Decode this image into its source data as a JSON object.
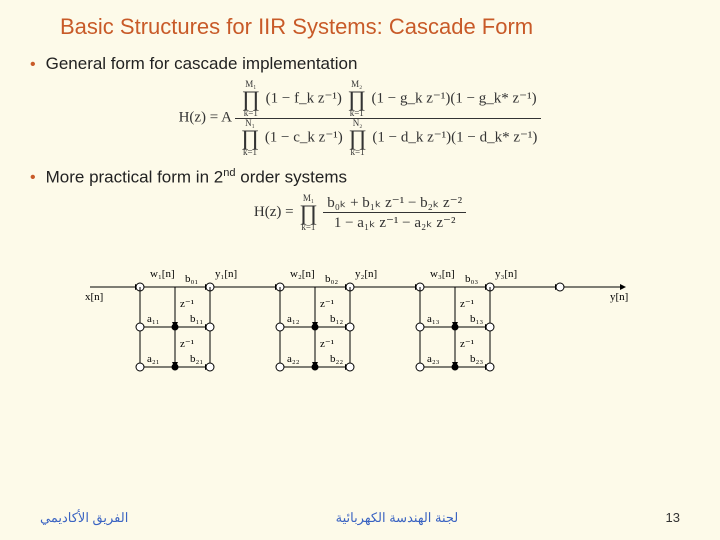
{
  "title": "Basic Structures for IIR Systems: Cascade Form",
  "bullets": {
    "b1": "General form for cascade implementation",
    "b2_pre": "More practical form in 2",
    "b2_ord": "nd",
    "b2_post": " order systems"
  },
  "eq1": {
    "lhs": "H(z) = A",
    "num_p1_top": "M₁",
    "num_p1_bot": "k=1",
    "num_p1_body": "(1 − f_k z⁻¹)",
    "num_p2_top": "M₂",
    "num_p2_bot": "k=1",
    "num_p2_body": "(1 − g_k z⁻¹)(1 − g_k* z⁻¹)",
    "den_p1_top": "N₁",
    "den_p1_bot": "k=1",
    "den_p1_body": "(1 − c_k z⁻¹)",
    "den_p2_top": "N₂",
    "den_p2_bot": "k=1",
    "den_p2_body": "(1 − d_k z⁻¹)(1 − d_k* z⁻¹)"
  },
  "eq2": {
    "lhs": "H(z) =",
    "prod_top": "M₁",
    "prod_bot": "k=1",
    "num": "b₀ₖ + b₁ₖ z⁻¹ − b₂ₖ z⁻²",
    "den": "1 − a₁ₖ z⁻¹ − a₂ₖ z⁻²"
  },
  "diagram": {
    "xin": "x[n]",
    "yout": "y[n]",
    "w1": "w₁[n]",
    "y1": "y₁[n]",
    "w2": "w₂[n]",
    "y2": "y₂[n]",
    "w3": "w₃[n]",
    "y3": "y₃[n]",
    "b01": "b₀₁",
    "b02": "b₀₂",
    "b03": "b₀₃",
    "a11": "a₁₁",
    "b11": "b₁₁",
    "a21": "a₂₁",
    "b21": "b₂₁",
    "a12": "a₁₂",
    "b12": "b₁₂",
    "a22": "a₂₂",
    "b22": "b₂₂",
    "a13": "a₁₃",
    "b13": "b₁₃",
    "a23": "a₂₃",
    "b23": "b₂₃",
    "zinv": "z⁻¹"
  },
  "footer": {
    "left": "الفريق الأكاديمي",
    "center": "لجنة الهندسة الكهربائية",
    "page": "13"
  }
}
